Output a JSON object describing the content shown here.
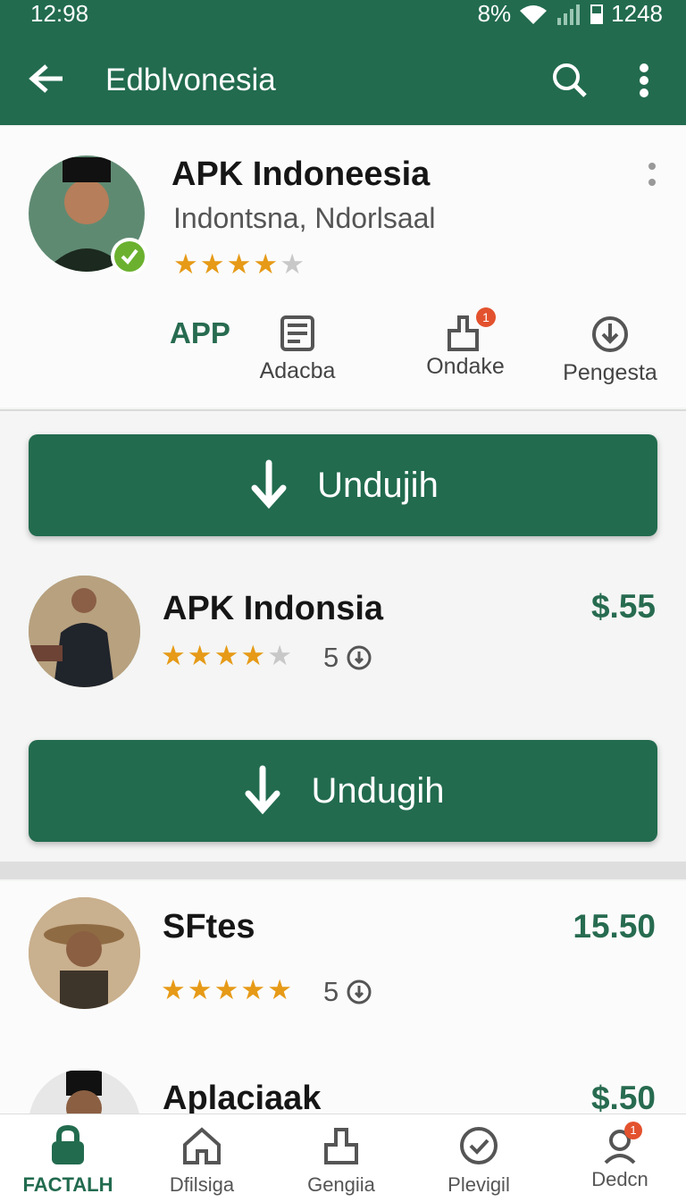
{
  "status": {
    "time": "12:98",
    "battery": "8%",
    "clock": "1248"
  },
  "toolbar": {
    "title": "Edblvonesia",
    "back_icon": "back-arrow-icon",
    "search_icon": "search-icon",
    "menu_icon": "more-vertical-icon"
  },
  "header_app": {
    "name": "APK Indoneesia",
    "subtitle": "Indontsna, Ndorlsaal",
    "rating": 4.5,
    "tag": "APP",
    "actions": [
      {
        "label": "Adacba",
        "icon": "document-list-icon"
      },
      {
        "label": "Ondake",
        "icon": "share-icon",
        "badge": "1"
      },
      {
        "label": "Pengesta",
        "icon": "download-circle-icon"
      }
    ]
  },
  "download_label": "Undujih",
  "list": [
    {
      "name": "APK Indonsia",
      "price": "$.55",
      "rating": 4.5,
      "count": "5",
      "button": "Undugih"
    },
    {
      "name": "SFtes",
      "price": "15.50",
      "rating": 5,
      "count": "5"
    },
    {
      "name": "Aplaciaak",
      "price": "$.50"
    }
  ],
  "bottom_nav": [
    {
      "label": "FACTALH",
      "icon": "lock-bag-icon",
      "active": true
    },
    {
      "label": "Dfilsiga",
      "icon": "home-icon"
    },
    {
      "label": "Gengiia",
      "icon": "share-up-icon"
    },
    {
      "label": "Plevigil",
      "icon": "check-circle-icon"
    },
    {
      "label": "Dedcn",
      "icon": "person-icon",
      "badge": "1"
    }
  ],
  "colors": {
    "primary": "#226b4f",
    "star": "#e69a17",
    "badge": "#e3522e"
  }
}
